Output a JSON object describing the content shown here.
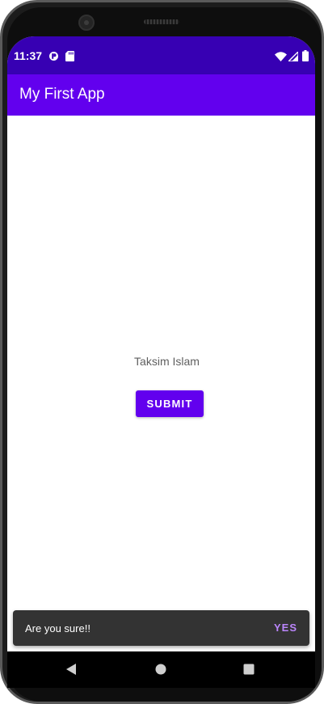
{
  "status_bar": {
    "time": "11:37",
    "icons": [
      "data-saver-icon",
      "sd-card-icon",
      "wifi-icon",
      "signal-icon",
      "battery-icon"
    ]
  },
  "app_bar": {
    "title": "My First App"
  },
  "main": {
    "name_text": "Taksim Islam",
    "submit_label": "SUBMIT"
  },
  "snackbar": {
    "message": "Are you sure!!",
    "action_label": "YES"
  },
  "navigation_bar": {
    "buttons": [
      "back-icon",
      "home-icon",
      "recents-icon"
    ]
  },
  "colors": {
    "status_bar": "#3700B3",
    "app_bar": "#6200EE",
    "button": "#6200EE",
    "snackbar_bg": "#333333",
    "snackbar_action": "#BB86FC"
  }
}
